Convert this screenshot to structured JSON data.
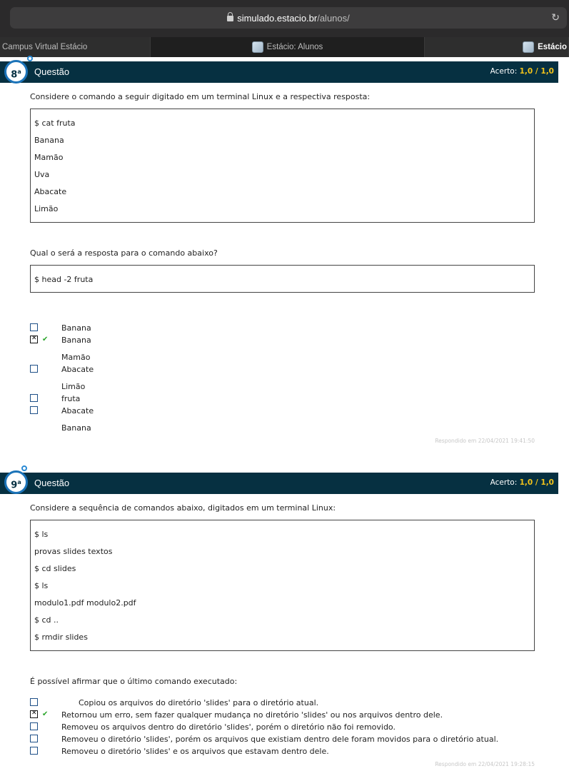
{
  "browser": {
    "url_domain": "simulado.estacio.br",
    "url_path": "/alunos/",
    "tabs": [
      "Campus Virtual Estácio",
      "Estácio: Alunos",
      "Estácio"
    ]
  },
  "q8": {
    "number": "8",
    "ordinal": "a",
    "title": "Questão",
    "score_label": "Acerto:",
    "score_value": "1,0",
    "score_sep": " / ",
    "score_max": "1,0",
    "prompt": "Considere o comando a seguir digitado em um terminal Linux e a respectiva resposta:",
    "code1": [
      "$ cat fruta",
      "Banana",
      "Mamão",
      "Uva",
      "Abacate",
      "Limão"
    ],
    "prompt2": "Qual o será a resposta para o comando abaixo?",
    "code2": "$ head -2 fruta",
    "options_text": [
      "Banana",
      "Banana",
      "Mamão",
      "Abacate",
      "Limão",
      "fruta",
      "Abacate",
      "Banana"
    ],
    "checked_option": 2,
    "answered": "Respondido em 22/04/2021 19:41:50"
  },
  "q9": {
    "number": "9",
    "ordinal": "a",
    "title": "Questão",
    "score_label": "Acerto:",
    "score_value": "1,0",
    "score_sep": " / ",
    "score_max": "1,0",
    "prompt": "Considere a sequência de comandos abaixo, digitados em um terminal Linux:",
    "code": [
      "$ ls",
      "provas  slides  textos",
      "$ cd slides",
      "$ ls",
      "modulo1.pdf  modulo2.pdf",
      "$ cd ..",
      "$ rmdir slides"
    ],
    "prompt2": "É possível afirmar que o último comando executado:",
    "options": [
      "Copiou os arquivos do diretório 'slides' para o diretório atual.",
      "Retornou um erro, sem fazer qualquer mudança no diretório 'slides' ou nos arquivos dentro dele.",
      "Removeu os arquivos dentro do diretório 'slides', porém o diretório não foi removido.",
      "Removeu o diretório 'slides', porém os arquivos que existiam dentro dele foram movidos para o diretório atual.",
      "Removeu o diretório 'slides' e os arquivos que estavam dentro dele."
    ],
    "checked_option": 2,
    "answered": "Respondido em 22/04/2021 19:28:15"
  },
  "colors": {
    "header_bg": "#063041",
    "score_accent": "#f2c31a",
    "badge_ring": "#1b73b8",
    "correct_tick": "#2aa52a"
  },
  "icons": [
    "lock-icon",
    "reload-icon",
    "favicon-icon",
    "check-icon"
  ]
}
